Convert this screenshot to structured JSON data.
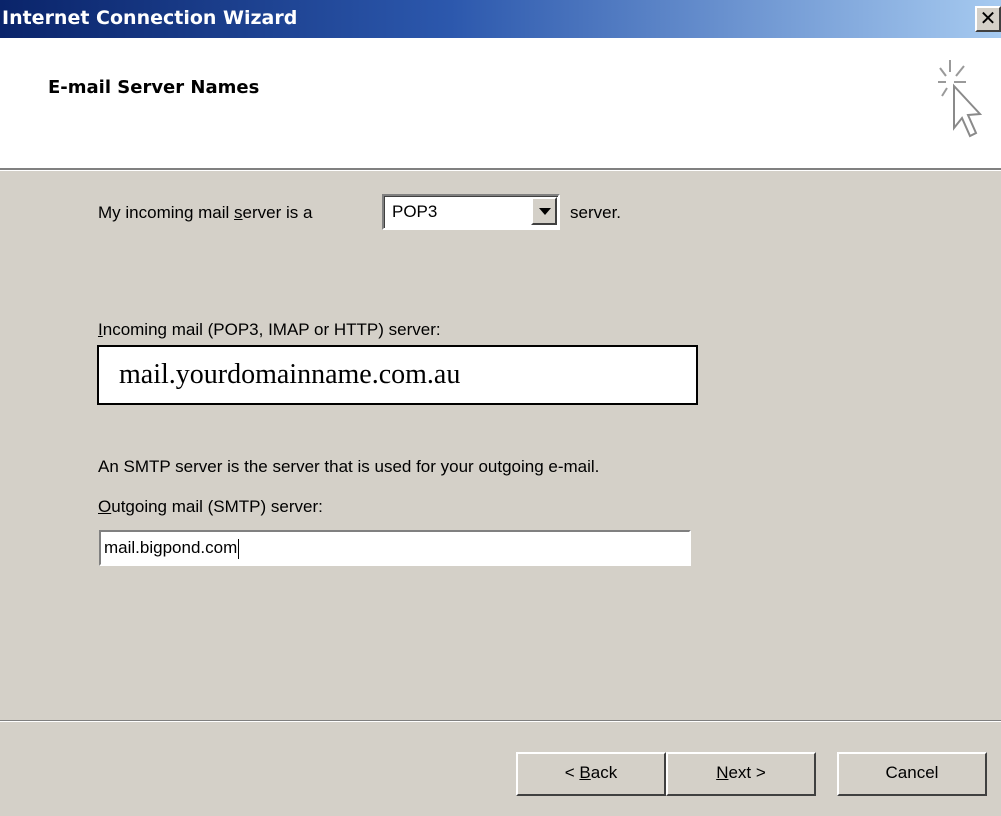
{
  "window": {
    "title": "Internet Connection Wizard",
    "close_label": "✕"
  },
  "header": {
    "title": "E-mail Server Names",
    "icon": "wizard-cursor-sparkle-icon"
  },
  "server_type": {
    "prefix": "My incoming mail ",
    "prefix_accel": "s",
    "prefix_rest": "erver is a",
    "selected": "POP3",
    "suffix": "server."
  },
  "incoming": {
    "label_accel": "I",
    "label_rest": "ncoming mail (POP3, IMAP or HTTP) server:",
    "value": "mail.yourdomainname.com.au"
  },
  "smtp_info": "An SMTP server is the server that is used for your outgoing e-mail.",
  "outgoing": {
    "label_accel": "O",
    "label_rest": "utgoing mail (SMTP) server:",
    "value": "mail.bigpond.com"
  },
  "buttons": {
    "back_prefix": "< ",
    "back_accel": "B",
    "back_rest": "ack",
    "next_accel": "N",
    "next_rest": "ext >",
    "cancel": "Cancel"
  }
}
